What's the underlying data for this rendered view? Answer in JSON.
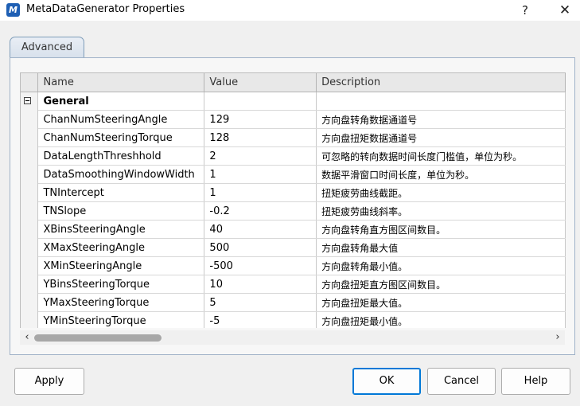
{
  "window": {
    "app_icon_glyph": "M",
    "title": "MetaDataGenerator Properties",
    "help_glyph": "?",
    "close_glyph": "✕"
  },
  "tabs": [
    {
      "label": "Advanced",
      "active": true
    }
  ],
  "grid": {
    "columns": [
      "Name",
      "Value",
      "Description"
    ],
    "category": "General",
    "rows": [
      {
        "name": "ChanNumSteeringAngle",
        "value": "129",
        "description": "方向盘转角数据通道号"
      },
      {
        "name": "ChanNumSteeringTorque",
        "value": "128",
        "description": "方向盘扭矩数据通道号"
      },
      {
        "name": "DataLengthThreshhold",
        "value": "2",
        "description": "可忽略的转向数据时间长度门槛值，单位为秒。"
      },
      {
        "name": "DataSmoothingWindowWidth",
        "value": "1",
        "description": "数据平滑窗口时间长度，单位为秒。"
      },
      {
        "name": "TNIntercept",
        "value": "1",
        "description": "扭矩疲劳曲线截距。"
      },
      {
        "name": "TNSlope",
        "value": "-0.2",
        "description": "扭矩疲劳曲线斜率。"
      },
      {
        "name": "XBinsSteeringAngle",
        "value": "40",
        "description": "方向盘转角直方图区间数目。"
      },
      {
        "name": "XMaxSteeringAngle",
        "value": "500",
        "description": "方向盘转角最大值"
      },
      {
        "name": "XMinSteeringAngle",
        "value": "-500",
        "description": "方向盘转角最小值。"
      },
      {
        "name": "YBinsSteeringTorque",
        "value": "10",
        "description": "方向盘扭矩直方图区间数目。"
      },
      {
        "name": "YMaxSteeringTorque",
        "value": "5",
        "description": "方向盘扭矩最大值。"
      },
      {
        "name": "YMinSteeringTorque",
        "value": "-5",
        "description": "方向盘扭矩最小值。"
      }
    ]
  },
  "scrollbar": {
    "left_glyph": "‹",
    "right_glyph": "›"
  },
  "buttons": {
    "apply": "Apply",
    "ok": "OK",
    "cancel": "Cancel",
    "help": "Help"
  },
  "colors": {
    "accent": "#0078d7",
    "app_icon": "#1e5fb4"
  }
}
